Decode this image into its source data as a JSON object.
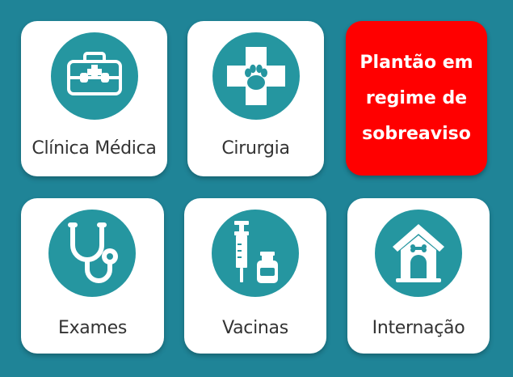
{
  "colors": {
    "background": "#1f8497",
    "card": "#ffffff",
    "icon_circle": "#2596a0",
    "alert": "#ff0000",
    "label_text": "#333333"
  },
  "services": [
    {
      "label": "Clínica Médica",
      "icon": "medical-kit-icon"
    },
    {
      "label": "Cirurgia",
      "icon": "paw-cross-icon"
    },
    {
      "lines": [
        "Plantão em",
        "regime de",
        "sobreaviso"
      ]
    },
    {
      "label": "Exames",
      "icon": "stethoscope-icon"
    },
    {
      "label": "Vacinas",
      "icon": "syringe-vial-icon"
    },
    {
      "label": "Internação",
      "icon": "dog-house-icon"
    }
  ]
}
